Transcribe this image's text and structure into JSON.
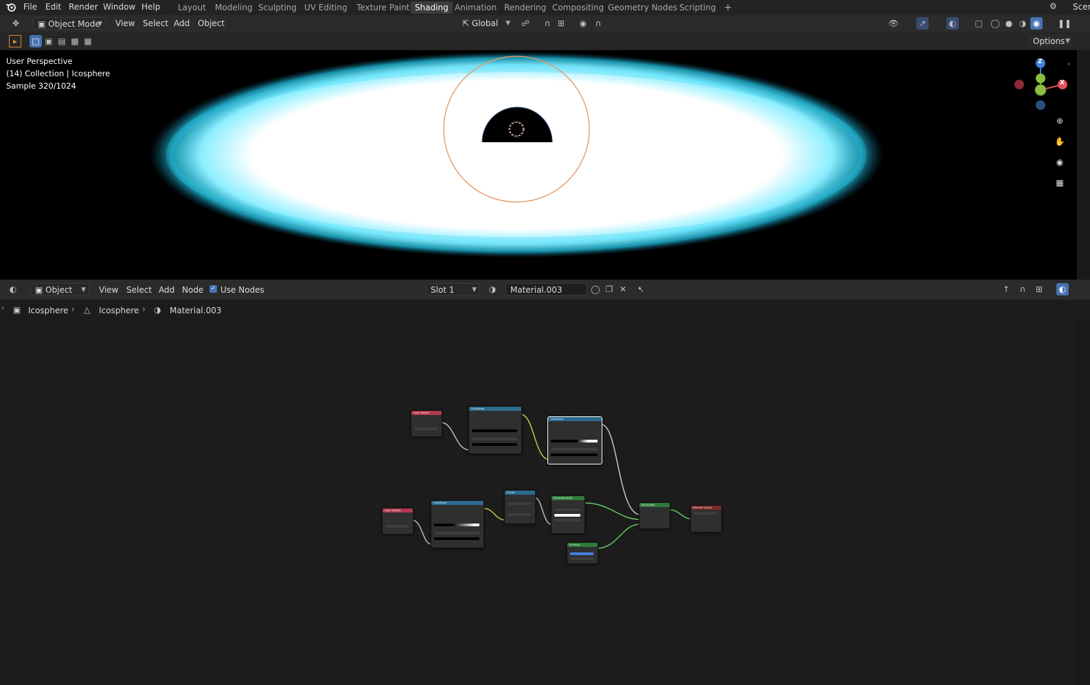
{
  "menu": {
    "items": [
      "File",
      "Edit",
      "Render",
      "Window",
      "Help"
    ]
  },
  "workspaces": {
    "tabs": [
      "Layout",
      "Modeling",
      "Sculpting",
      "UV Editing",
      "Texture Paint",
      "Shading",
      "Animation",
      "Rendering",
      "Compositing",
      "Geometry Nodes",
      "Scripting"
    ],
    "active": "Shading",
    "add_label": "+",
    "scene_label": "Scen"
  },
  "viewport_header": {
    "mode": "Object Mode",
    "menus": [
      "View",
      "Select",
      "Add",
      "Object"
    ],
    "orientation": "Global",
    "options_label": "Options"
  },
  "viewport": {
    "overlay_lines": [
      "User Perspective",
      "(14) Collection | Icosphere",
      "Sample 320/1024"
    ],
    "gizmo": {
      "z": "Z",
      "y": "Y",
      "x": "X"
    }
  },
  "node_header": {
    "object_type": "Object",
    "menus": [
      "View",
      "Select",
      "Add",
      "Node"
    ],
    "use_nodes_label": "Use Nodes",
    "use_nodes_checked": true,
    "slot": "Slot 1",
    "material": "Material.003"
  },
  "breadcrumb": {
    "items": [
      "Icosphere",
      "Icosphere",
      "Material.003"
    ]
  },
  "nodes": [
    {
      "title": "Layer Weight",
      "color": "#b2394e"
    },
    {
      "title": "ColorRamp",
      "color": "#2d6b8f"
    },
    {
      "title": "ColorRamp",
      "color": "#2d6b8f"
    },
    {
      "title": "Layer Weight",
      "color": "#b2394e"
    },
    {
      "title": "ColorRamp",
      "color": "#2d6b8f"
    },
    {
      "title": "Divide",
      "color": "#2d6b8f"
    },
    {
      "title": "Refraction BSDF",
      "color": "#2e7b3b"
    },
    {
      "title": "Emission",
      "color": "#2e7b3b"
    },
    {
      "title": "Mix Shader",
      "color": "#2e7b3b"
    },
    {
      "title": "Material Output",
      "color": "#7a2a2a"
    }
  ],
  "colors": {
    "accent": "#4772b3",
    "active_tab": "#3c3c3c",
    "disk_glow": "#35d7ff",
    "shader_link": "#63c763",
    "gizmo_x": "#e8505a",
    "gizmo_y": "#8cbf3f",
    "gizmo_z": "#3d7fd6"
  }
}
